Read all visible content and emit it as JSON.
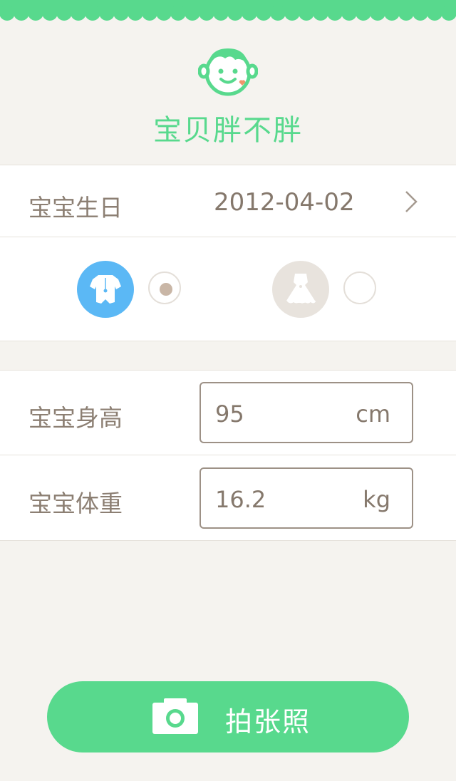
{
  "header": {
    "title": "宝贝胖不胖",
    "logo_icon": "baby-face-icon"
  },
  "birthday": {
    "label": "宝宝生日",
    "value": "2012-04-02",
    "chevron_icon": "chevron-right-icon"
  },
  "gender": {
    "options": [
      {
        "icon": "boy-romper-icon",
        "selected": true
      },
      {
        "icon": "girl-dress-icon",
        "selected": false
      }
    ]
  },
  "height": {
    "label": "宝宝身高",
    "value": "95",
    "unit": "cm"
  },
  "weight": {
    "label": "宝宝体重",
    "value": "16.2",
    "unit": "kg"
  },
  "photo_button": {
    "label": "拍张照",
    "icon": "camera-icon"
  },
  "colors": {
    "accent": "#58d98d",
    "boy": "#5bb8f5",
    "girl_inactive": "#e8e3dd",
    "text": "#8c7f73",
    "background": "#f5f3ef"
  }
}
